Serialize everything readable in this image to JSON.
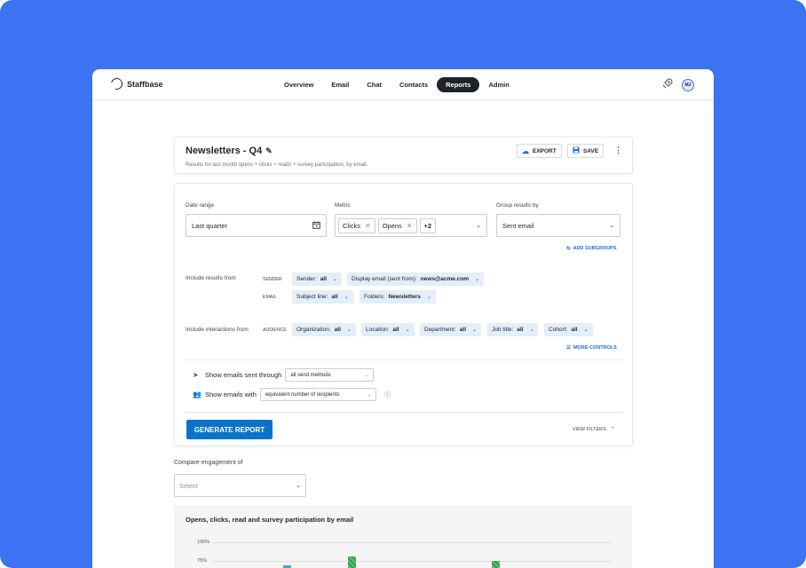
{
  "app": {
    "brand": "Staffbase"
  },
  "nav": {
    "items": [
      {
        "label": "Overview"
      },
      {
        "label": "Email"
      },
      {
        "label": "Chat"
      },
      {
        "label": "Contacts"
      },
      {
        "label": "Reports"
      },
      {
        "label": "Admin"
      }
    ],
    "active": "Reports",
    "avatar": "MJ"
  },
  "report": {
    "title": "Newsletters - Q4",
    "subtitle": "Results for last month opens + clicks + reads + survey participation, by email.",
    "export_label": "EXPORT",
    "save_label": "SAVE"
  },
  "filters": {
    "date_label": "Date range",
    "date_value": "Last quarter",
    "metric_label": "Metric",
    "metric_chips": [
      "Clicks",
      "Opens"
    ],
    "metric_more": "+2",
    "group_label": "Group results by",
    "group_value": "Sent email",
    "add_subgroups": "ADD SUBGROUPS",
    "include_results_label": "Include results from",
    "sender_cat": "SENDER",
    "email_cat": "EMAIL",
    "sender_tag_key": "Sender:",
    "sender_tag_val": "all",
    "display_email_key": "Display email (sent from):",
    "display_email_val": "news@acme.com",
    "subject_key": "Subject line:",
    "subject_val": "all",
    "folders_key": "Folders:",
    "folders_val": "Newsletters",
    "interactions_label": "Include interactions from",
    "audience_cat": "AUDIENCE",
    "org_key": "Organization:",
    "org_val": "all",
    "loc_key": "Location:",
    "loc_val": "all",
    "dept_key": "Department:",
    "dept_val": "all",
    "job_key": "Job title:",
    "job_val": "all",
    "cohort_key": "Cohort:",
    "cohort_val": "all",
    "more_controls": "MORE CONTROLS",
    "sent_through_label": "Show emails sent through",
    "sent_through_value": "all send methods",
    "show_with_label": "Show emails with",
    "show_with_value": "equivalent number of recipients",
    "generate_label": "GENERATE REPORT",
    "view_filters": "VIEW FILTERS"
  },
  "compare": {
    "label": "Compare engagement of",
    "placeholder": "Select"
  },
  "chart_data": {
    "type": "bar",
    "title": "Opens, clicks, read and survey participation by email",
    "yticks": [
      "100%",
      "75%"
    ],
    "ylim": [
      0,
      100
    ]
  },
  "colors": {
    "background": "#3b73f3",
    "accent": "#0a73c9",
    "tag": "#e3eef8",
    "bar": "#2f9e4f"
  }
}
